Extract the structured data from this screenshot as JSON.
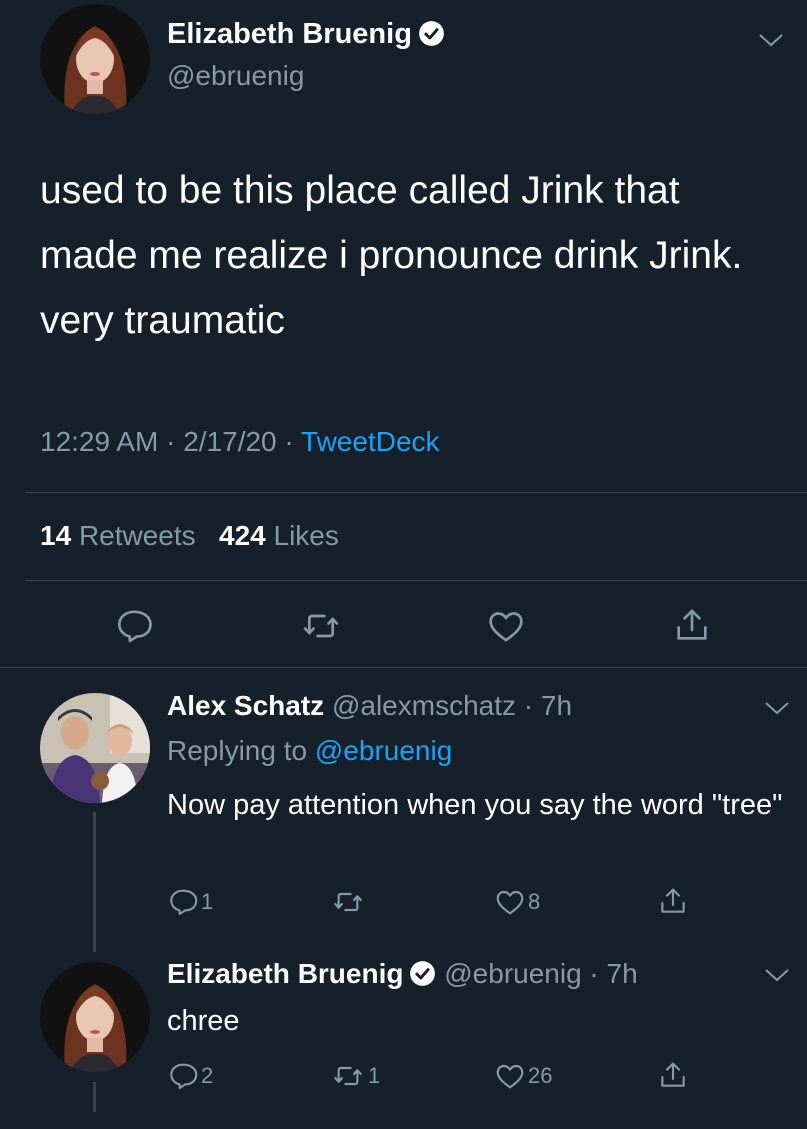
{
  "main_tweet": {
    "author_name": "Elizabeth Bruenig",
    "author_handle": "@ebruenig",
    "text": "used to be this place called Jrink that made me realize i pronounce drink Jrink. very traumatic",
    "time": "12:29 AM",
    "sep1": " · ",
    "date": "2/17/20",
    "sep2": " · ",
    "source": "TweetDeck",
    "retweets_count": "14",
    "retweets_label": "Retweets",
    "likes_count": "424",
    "likes_label": "Likes"
  },
  "replies": [
    {
      "author_name": "Alex Schatz",
      "author_handle": "@alexmschatz",
      "dot": " · ",
      "age": "7h",
      "replying_prefix": "Replying to ",
      "replying_to": "@ebruenig",
      "text": "Now pay attention when you say the word \"tree\"",
      "reply_count": "1",
      "retweet_count": "",
      "like_count": "8"
    },
    {
      "author_name": "Elizabeth Bruenig",
      "author_handle": "@ebruenig",
      "dot": " · ",
      "age": "7h",
      "text": "chree",
      "reply_count": "2",
      "retweet_count": "1",
      "like_count": "26"
    }
  ],
  "icons": {
    "reply": "reply-icon",
    "retweet": "retweet-icon",
    "like": "heart-icon",
    "share": "share-icon",
    "more": "chevron-down-icon",
    "verified": "verified-badge-icon"
  },
  "colors": {
    "background": "#15202b",
    "text": "#ffffff",
    "muted": "#8899a6",
    "link": "#1da1f2",
    "divider": "#38444d"
  }
}
